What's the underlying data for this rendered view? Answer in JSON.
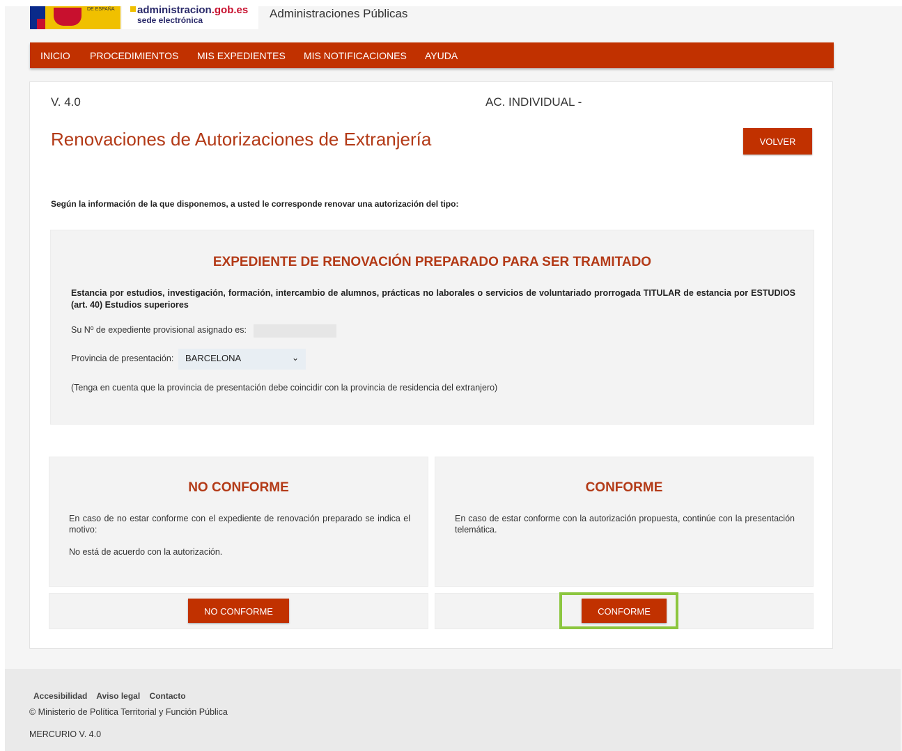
{
  "header": {
    "flag_label": "DE ESPAÑA",
    "logo_main": "administracion",
    "logo_domain": ".gob.es",
    "logo_sub": "sede electrónica",
    "section_title": "Administraciones Públicas"
  },
  "nav": {
    "items": [
      "INICIO",
      "PROCEDIMIENTOS",
      "MIS EXPEDIENTES",
      "MIS NOTIFICACIONES",
      "AYUDA"
    ]
  },
  "page": {
    "version": "V. 4.0",
    "ac_individual": "AC. INDIVIDUAL -",
    "title": "Renovaciones de Autorizaciones de Extranjería",
    "volver_label": "VOLVER",
    "intro": "Según la información de la que disponemos, a usted le corresponde renovar una autorización del tipo:"
  },
  "panel": {
    "title": "EXPEDIENTE DE RENOVACIÓN PREPARADO PARA SER TRAMITADO",
    "description": "Estancia por estudios, investigación, formación, intercambio de alumnos, prácticas no laborales o servicios de voluntariado prorrogada TITULAR de estancia por ESTUDIOS (art. 40) Estudios superiores",
    "expediente_label": "Su Nº de expediente provisional asignado es:",
    "provincia_label": "Provincia de presentación:",
    "provincia_value": "BARCELONA",
    "note": "(Tenga en cuenta que la provincia de presentación debe coincidir con la provincia de residencia del extranjero)"
  },
  "no_conforme": {
    "title": "NO CONFORME",
    "text": "En caso de no estar conforme con el expediente de renovación preparado se indica el motivo:",
    "reason": "No está de acuerdo con la autorización.",
    "button": "NO CONFORME"
  },
  "conforme": {
    "title": "CONFORME",
    "text": "En caso de estar conforme con la autorización propuesta, continúe con la presentación telemática.",
    "button": "CONFORME"
  },
  "footer": {
    "links": [
      "Accesibilidad",
      "Aviso legal",
      "Contacto"
    ],
    "copyright": "© Ministerio de Política Territorial y Función Pública",
    "version": "MERCURIO V. 4.0"
  },
  "colors": {
    "brand": "#c13100",
    "title": "#b33a17",
    "highlight": "#8cc63f"
  }
}
